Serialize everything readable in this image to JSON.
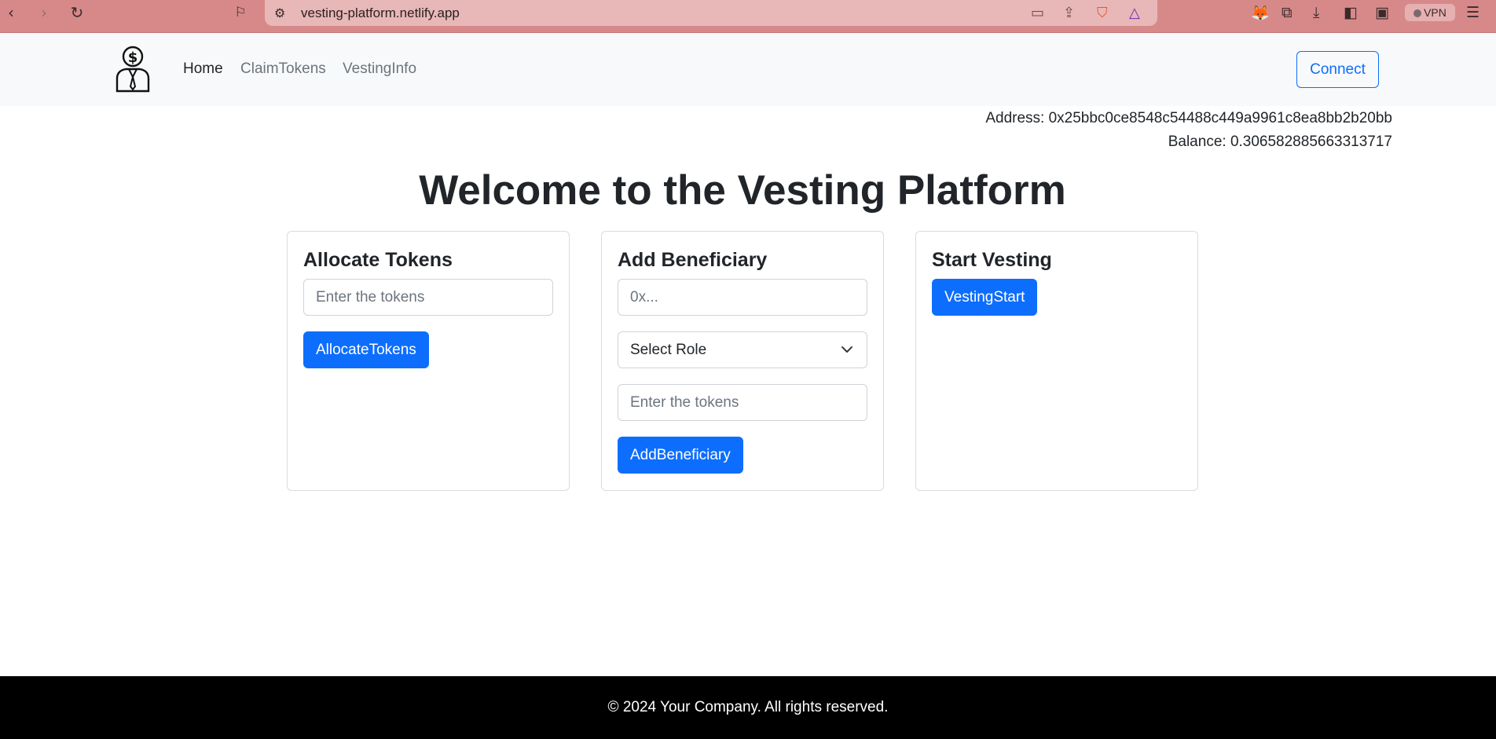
{
  "browser": {
    "url": "vesting-platform.netlify.app",
    "vpn_label": "VPN"
  },
  "nav": {
    "links": [
      "Home",
      "ClaimTokens",
      "VestingInfo"
    ],
    "connect_label": "Connect"
  },
  "account": {
    "address": "Address: 0x25bbc0ce8548c54488c449a9961c8ea8bb2b20bb",
    "balance": "Balance: 0.306582885663313717"
  },
  "page_title": "Welcome to the Vesting Platform",
  "allocate": {
    "title": "Allocate Tokens",
    "placeholder": "Enter the tokens",
    "button": "AllocateTokens"
  },
  "beneficiary": {
    "title": "Add Beneficiary",
    "address_placeholder": "0x...",
    "role_select": "Select Role",
    "tokens_placeholder": "Enter the tokens",
    "button": "AddBeneficiary"
  },
  "vesting": {
    "title": "Start Vesting",
    "button": "VestingStart"
  },
  "footer": "© 2024 Your Company. All rights reserved.",
  "colors": {
    "primary": "#0d6efd",
    "navbar_bg": "#f8f9fa",
    "chrome_bg": "#d7898a",
    "footer_bg": "#000000"
  }
}
